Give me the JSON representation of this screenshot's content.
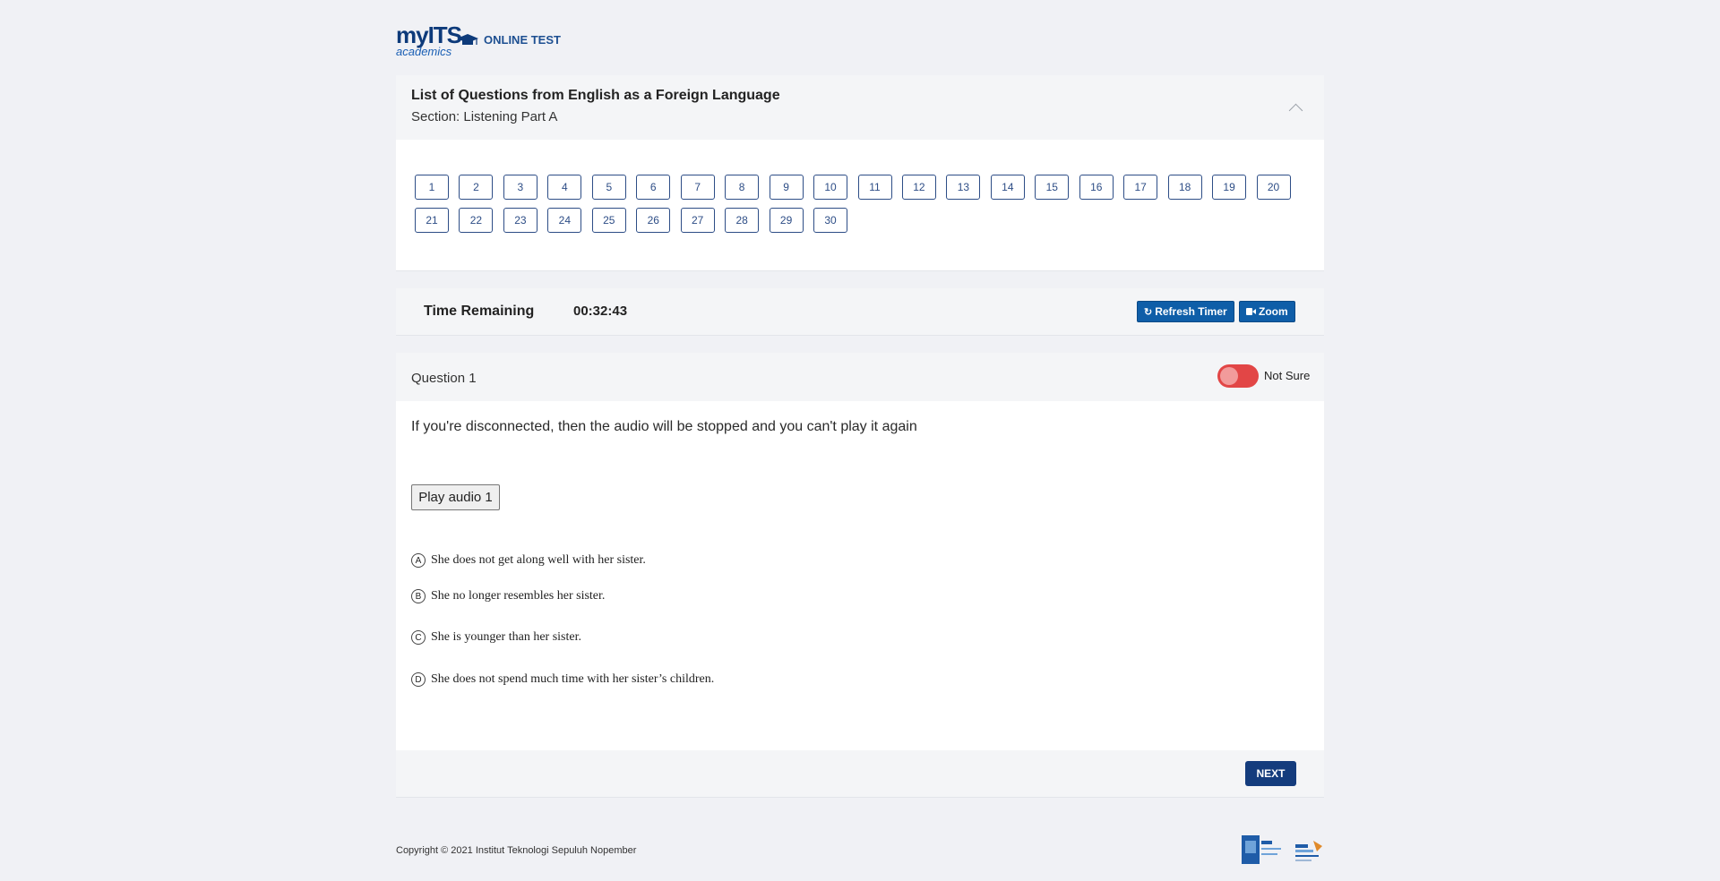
{
  "header": {
    "logo_my": "myITS",
    "logo_sub": "academics",
    "title": "ONLINE TEST"
  },
  "question_list": {
    "heading": "List of Questions from English as a Foreign Language",
    "section": "Section: Listening Part A",
    "numbers": [
      "1",
      "2",
      "3",
      "4",
      "5",
      "6",
      "7",
      "8",
      "9",
      "10",
      "11",
      "12",
      "13",
      "14",
      "15",
      "16",
      "17",
      "18",
      "19",
      "20",
      "21",
      "22",
      "23",
      "24",
      "25",
      "26",
      "27",
      "28",
      "29",
      "30"
    ]
  },
  "timer": {
    "label": "Time Remaining",
    "value": "00:32:43",
    "refresh_label": "Refresh Timer",
    "zoom_label": "Zoom"
  },
  "question": {
    "title": "Question 1",
    "not_sure_label": "Not Sure",
    "text": "If you're disconnected, then the audio will be stopped and you can't play it again",
    "play_label": "Play audio 1",
    "options": [
      {
        "letter": "A",
        "text": "She does not get along well with her sister."
      },
      {
        "letter": "B",
        "text": "She no longer resembles her sister."
      },
      {
        "letter": "C",
        "text": "She is younger than her sister."
      },
      {
        "letter": "D",
        "text": "She does not spend much time with her sister’s children."
      }
    ],
    "next_label": "NEXT"
  },
  "footer": {
    "copyright": "Copyright © 2021 Institut Teknologi Sepuluh Nopember"
  },
  "colors": {
    "brand_navy": "#143c7d",
    "button_blue": "#0f5ea8",
    "toggle_red": "#e24646",
    "background": "#f0f1f5"
  }
}
